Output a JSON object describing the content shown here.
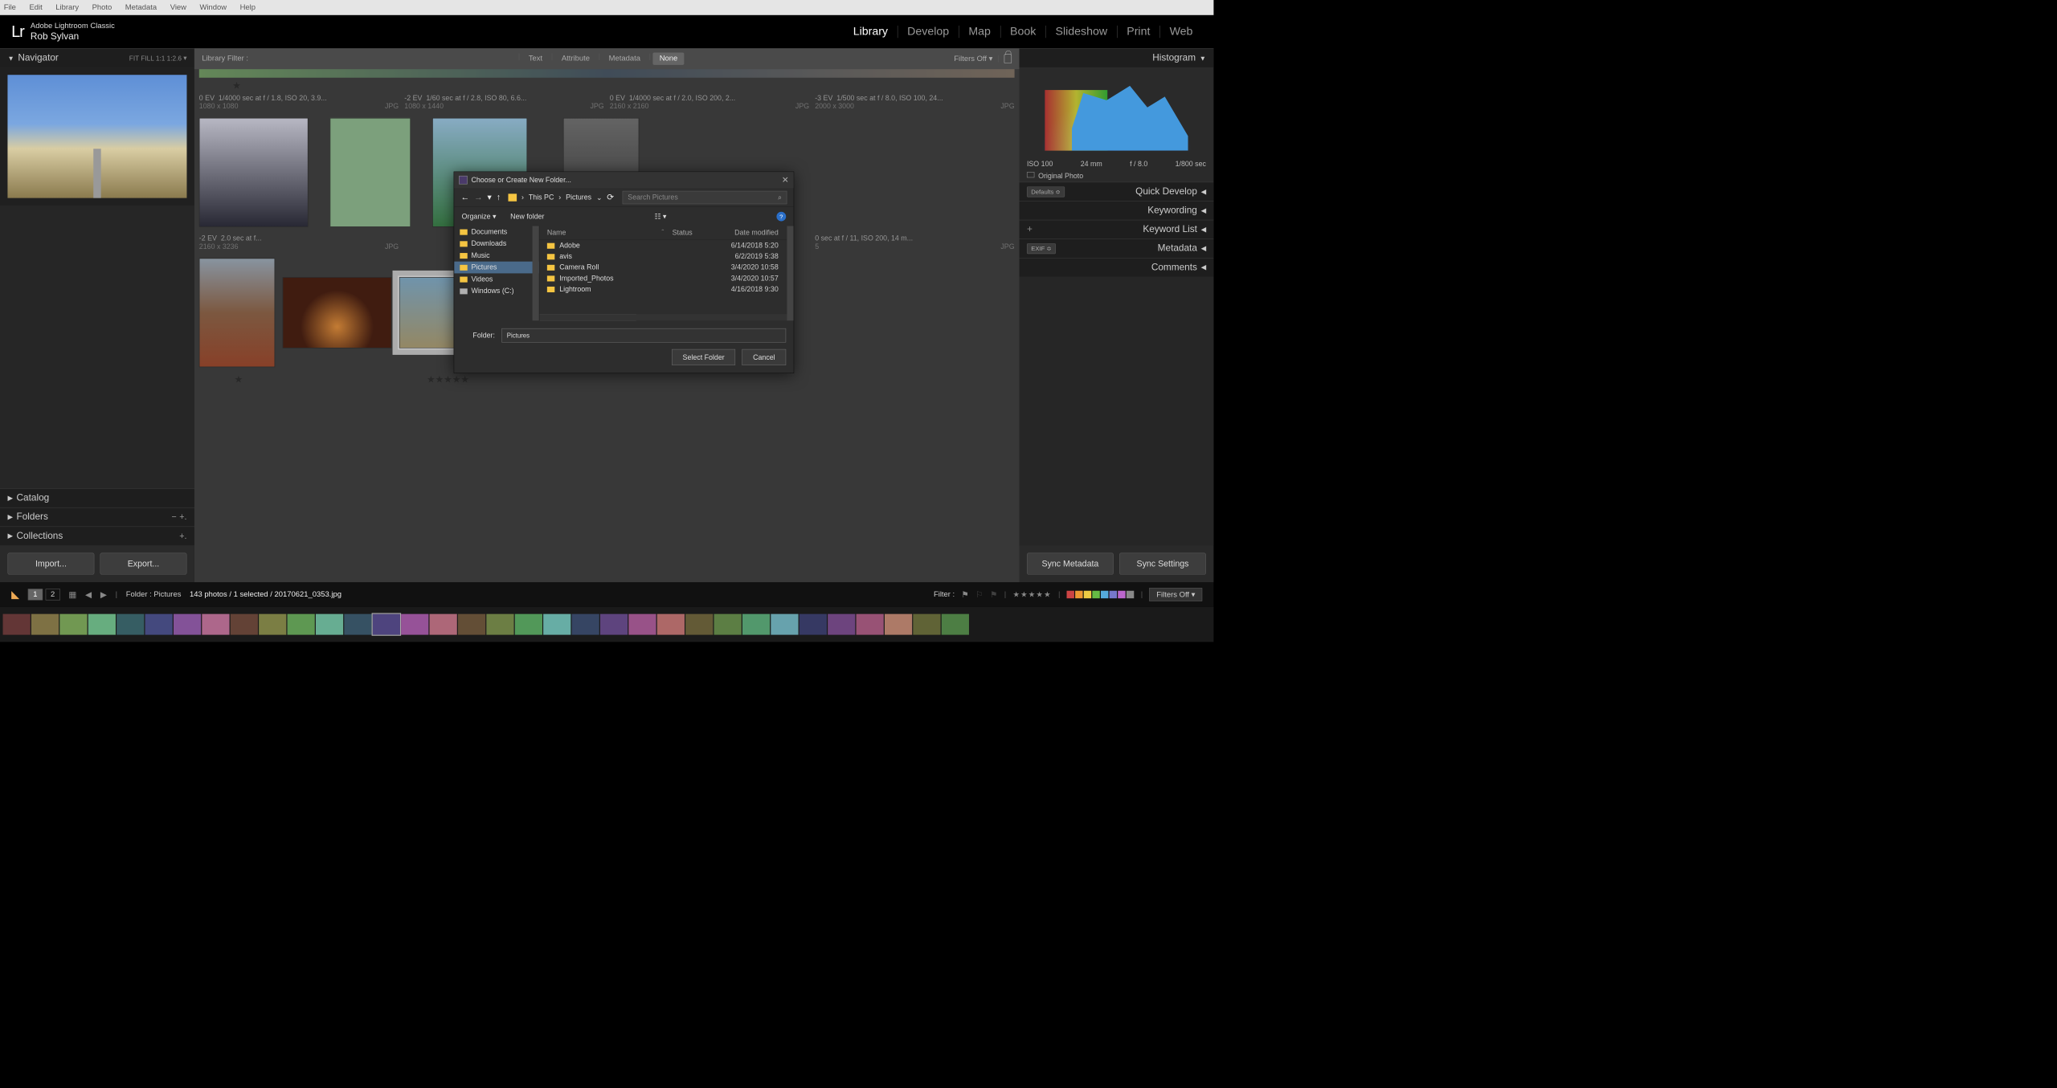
{
  "os_menu": [
    "File",
    "Edit",
    "Library",
    "Photo",
    "Metadata",
    "View",
    "Window",
    "Help"
  ],
  "app": {
    "name": "Adobe Lightroom Classic",
    "user": "Rob Sylvan",
    "logo": "Lr"
  },
  "modules": [
    "Library",
    "Develop",
    "Map",
    "Book",
    "Slideshow",
    "Print",
    "Web"
  ],
  "active_module": "Library",
  "navigator": {
    "title": "Navigator",
    "opts": "FIT   FILL   1:1   1:2.6"
  },
  "left_panels": {
    "catalog": "Catalog",
    "folders": "Folders",
    "collections": "Collections"
  },
  "buttons": {
    "import": "Import...",
    "export": "Export..."
  },
  "filterbar": {
    "label": "Library Filter :",
    "tabs": [
      "Text",
      "Attribute",
      "Metadata",
      "None"
    ],
    "active": "None",
    "filters_off": "Filters Off"
  },
  "grid_meta": [
    {
      "ev": "0 EV",
      "exp": "1/4000 sec at f / 1.8, ISO 20, 3.9...",
      "dim": "1080 x 1080",
      "fmt": "JPG"
    },
    {
      "ev": "-2 EV",
      "exp": "1/60 sec at f / 2.8, ISO 80, 6.6...",
      "dim": "1080 x 1440",
      "fmt": "JPG"
    },
    {
      "ev": "0 EV",
      "exp": "1/4000 sec at f / 2.0, ISO 200, 2...",
      "dim": "2160 x 2160",
      "fmt": "JPG"
    },
    {
      "ev": "-3 EV",
      "exp": "1/500 sec at f / 8.0, ISO 100, 24...",
      "dim": "2000 x 3000",
      "fmt": "JPG"
    }
  ],
  "grid_meta2": [
    {
      "ev": "-2 EV",
      "exp": "2.0 sec at f...",
      "dim": "2160 x 3236",
      "fmt": "JPG"
    },
    {
      "ev": "",
      "exp": "",
      "dim": "",
      "fmt": ""
    },
    {
      "ev": "",
      "exp": "",
      "dim": "",
      "fmt": ""
    },
    {
      "ev": "",
      "exp": "0 sec at f / 11, ISO 200, 14 m...",
      "dim": "5",
      "fmt": "JPG"
    }
  ],
  "dialog": {
    "title": "Choose or Create New Folder...",
    "crumb_root": "This PC",
    "crumb_leaf": "Pictures",
    "search_placeholder": "Search Pictures",
    "organize": "Organize",
    "newfolder": "New folder",
    "tree": [
      {
        "n": "Documents",
        "t": "f"
      },
      {
        "n": "Downloads",
        "t": "f"
      },
      {
        "n": "Music",
        "t": "f"
      },
      {
        "n": "Pictures",
        "t": "f",
        "sel": true
      },
      {
        "n": "Videos",
        "t": "f"
      },
      {
        "n": "Windows (C:)",
        "t": "d"
      }
    ],
    "cols": {
      "name": "Name",
      "status": "Status",
      "date": "Date modified"
    },
    "rows": [
      {
        "n": "Adobe",
        "d": "6/14/2018 5:20"
      },
      {
        "n": "avis",
        "d": "6/2/2019 5:38"
      },
      {
        "n": "Camera Roll",
        "d": "3/4/2020 10:58"
      },
      {
        "n": "Imported_Photos",
        "d": "3/4/2020 10:57"
      },
      {
        "n": "Lightroom",
        "d": "4/16/2018 9:30"
      }
    ],
    "folder_label": "Folder:",
    "folder_value": "Pictures",
    "select": "Select Folder",
    "cancel": "Cancel"
  },
  "right": {
    "histogram": "Histogram",
    "histo_meta": {
      "iso": "ISO 100",
      "focal": "24 mm",
      "ap": "f / 8.0",
      "sh": "1/800 sec"
    },
    "original": "Original Photo",
    "defaults": "Defaults",
    "panels": [
      "Quick Develop",
      "Keywording",
      "Keyword List",
      "Metadata",
      "Comments"
    ],
    "exif": "EXIF",
    "sync_meta": "Sync Metadata",
    "sync_set": "Sync Settings"
  },
  "toolbar": {
    "path": "Folder : Pictures",
    "count": "143 photos / 1 selected / 20170621_0353.jpg",
    "filter": "Filter :",
    "filters_off": "Filters Off",
    "view1": "1",
    "view2": "2"
  },
  "swatches": [
    "#c44",
    "#e93",
    "#ec4",
    "#6b4",
    "#5ad",
    "#77c",
    "#b6c",
    "#888"
  ]
}
